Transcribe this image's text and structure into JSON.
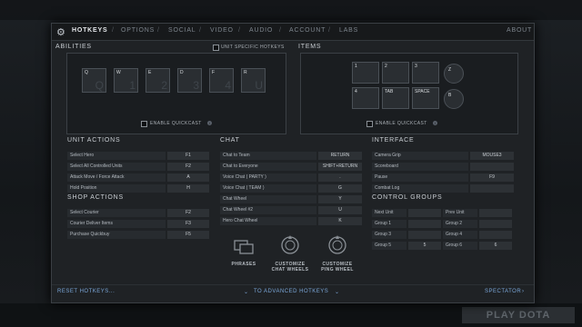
{
  "tabs": [
    "HOTKEYS",
    "OPTIONS",
    "SOCIAL",
    "VIDEO",
    "AUDIO",
    "ACCOUNT",
    "LABS"
  ],
  "about": "ABOUT",
  "abilities": {
    "title": "ABILITIES",
    "unit_specific": "UNIT SPECIFIC HOTKEYS",
    "keys": [
      {
        "label": "Q",
        "bg": "Q"
      },
      {
        "label": "W",
        "bg": "1"
      },
      {
        "label": "E",
        "bg": "2"
      },
      {
        "label": "D",
        "bg": "3"
      },
      {
        "label": "F",
        "bg": "4"
      },
      {
        "label": "R",
        "bg": "U"
      }
    ],
    "quickcast": "ENABLE QUICKCAST"
  },
  "items": {
    "title": "ITEMS",
    "row1": [
      "1",
      "2",
      "3"
    ],
    "circle1": "Z",
    "row2": [
      "4",
      "TAB",
      "SPACE"
    ],
    "circle2": "B",
    "quickcast": "ENABLE QUICKCAST"
  },
  "unit_actions": {
    "title": "UNIT ACTIONS",
    "rows": [
      {
        "label": "Select Hero",
        "key": "F1"
      },
      {
        "label": "Select All Controlled Units",
        "key": "F2"
      },
      {
        "label": "Attack Move / Force Attack",
        "key": "A"
      },
      {
        "label": "Hold Position",
        "key": "H"
      }
    ]
  },
  "shop_actions": {
    "title": "SHOP ACTIONS",
    "rows": [
      {
        "label": "Select Courier",
        "key": "F2"
      },
      {
        "label": "Courier Deliver Items",
        "key": "F3"
      },
      {
        "label": "Purchase Quickbuy",
        "key": "F5"
      }
    ]
  },
  "chat": {
    "title": "CHAT",
    "rows": [
      {
        "label": "Chat to Team",
        "key": "RETURN"
      },
      {
        "label": "Chat to Everyone",
        "key": "SHIFT+RETURN"
      },
      {
        "label": "Voice Chat ( PARTY )",
        "key": "."
      },
      {
        "label": "Voice Chat ( TEAM )",
        "key": "G"
      },
      {
        "label": "Chat Wheel",
        "key": "Y"
      },
      {
        "label": "Chat Wheel #2",
        "key": "U"
      },
      {
        "label": "Hero Chat Wheel",
        "key": "K"
      }
    ]
  },
  "interface": {
    "title": "INTERFACE",
    "rows": [
      {
        "label": "Camera Grip",
        "key": "MOUSE3"
      },
      {
        "label": "Scoreboard",
        "key": ""
      },
      {
        "label": "Pause",
        "key": "F9"
      },
      {
        "label": "Combat Log",
        "key": ""
      }
    ]
  },
  "control_groups": {
    "title": "CONTROL GROUPS",
    "left": [
      {
        "label": "Next Unit",
        "key": ""
      },
      {
        "label": "Group 1",
        "key": ""
      },
      {
        "label": "Group 3",
        "key": ""
      },
      {
        "label": "Group 5",
        "key": "5"
      }
    ],
    "right": [
      {
        "label": "Prev Unit",
        "key": ""
      },
      {
        "label": "Group 2",
        "key": ""
      },
      {
        "label": "Group 4",
        "key": ""
      },
      {
        "label": "Group 6",
        "key": "6"
      }
    ]
  },
  "wheels": {
    "phrases": "PHRASES",
    "chat_1": "CUSTOMIZE",
    "chat_2": "CHAT WHEELS",
    "ping_1": "CUSTOMIZE",
    "ping_2": "PING WHEEL"
  },
  "footer": {
    "reset": "RESET HOTKEYS...",
    "advanced": "TO ADVANCED HOTKEYS",
    "spectator": "SPECTATOR"
  },
  "play_button": "PLAY DOTA"
}
